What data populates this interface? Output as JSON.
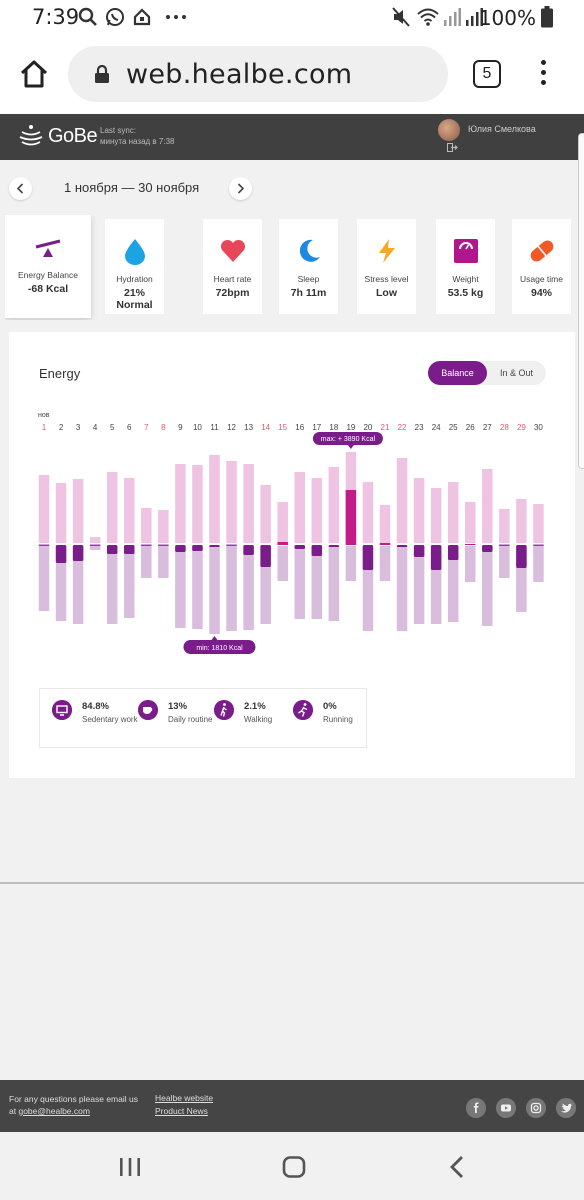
{
  "status_bar": {
    "time": "7:39",
    "battery": "100%",
    "icons": [
      "search-icon",
      "whatsapp-icon",
      "app-icon",
      "more-dots-icon",
      "mute-icon",
      "wifi-icon",
      "signal-icon",
      "battery-icon"
    ]
  },
  "browser": {
    "url": "web.healbe.com",
    "tab_count": "5"
  },
  "app_header": {
    "logo": "GoBe",
    "sync_label": "Last sync:",
    "sync_value": "минута назад в 7:38",
    "user_name": "Юлия Смелкова"
  },
  "date_nav": {
    "range": "1 ноября — 30 ноября"
  },
  "metrics": [
    {
      "label": "Energy Balance",
      "value": "-68 Kcal",
      "icon": "seesaw-icon",
      "color": "#7a1d8a"
    },
    {
      "label": "Hydration",
      "value": "21% Normal",
      "icon": "drop-icon",
      "color": "#1ba3e3"
    },
    {
      "label": "Heart rate",
      "value": "72bpm",
      "icon": "heart-icon",
      "color": "#e8475a"
    },
    {
      "label": "Sleep",
      "value": "7h 11m",
      "icon": "moon-icon",
      "color": "#1e88e5"
    },
    {
      "label": "Stress level",
      "value": "Low",
      "icon": "lightning-icon",
      "color": "#f9a825"
    },
    {
      "label": "Weight",
      "value": "53.5 kg",
      "icon": "scale-icon",
      "color": "#b3168a"
    },
    {
      "label": "Usage time",
      "value": "94%",
      "icon": "pill-icon",
      "color": "#f05a28"
    }
  ],
  "energy": {
    "title": "Energy",
    "toggle_on": "Balance",
    "toggle_off": "In & Out",
    "month_abbr": "нов",
    "max_label": "max: + 3890 Kcal",
    "min_label": "min: 1810 Kcal",
    "legend": [
      {
        "pct": "84.8%",
        "name": "Sedentary work",
        "icon": "monitor-icon"
      },
      {
        "pct": "13%",
        "name": "Daily routine",
        "icon": "cup-icon"
      },
      {
        "pct": "2.1%",
        "name": "Walking",
        "icon": "walking-icon"
      },
      {
        "pct": "0%",
        "name": "Running",
        "icon": "running-icon"
      }
    ]
  },
  "chart_data": {
    "type": "bar",
    "categories": [
      "1",
      "2",
      "3",
      "4",
      "5",
      "6",
      "7",
      "8",
      "9",
      "10",
      "11",
      "12",
      "13",
      "14",
      "15",
      "16",
      "17",
      "18",
      "19",
      "20",
      "21",
      "22",
      "23",
      "24",
      "25",
      "26",
      "27",
      "28",
      "29",
      "30"
    ],
    "weekend_days": [
      "1",
      "7",
      "8",
      "14",
      "15",
      "21",
      "22",
      "28",
      "29"
    ],
    "series": [
      {
        "values": [
          68,
          60,
          64,
          6,
          71,
          65,
          35,
          33,
          79,
          78,
          88,
          82,
          79,
          58,
          41,
          71,
          65,
          76,
          91,
          61,
          38,
          85,
          65,
          55,
          61,
          41,
          74,
          34,
          44,
          39
        ]
      },
      {
        "values": [
          -65,
          -75,
          -78,
          -4,
          -78,
          -72,
          -32,
          -32,
          -82,
          -83,
          -88,
          -85,
          -84,
          -78,
          -35,
          -73,
          -73,
          -75,
          -35,
          -85,
          -35,
          -85,
          -78,
          -78,
          -76,
          -36,
          -80,
          -32,
          -66,
          -36
        ]
      },
      {
        "values": [
          0,
          -18,
          -16,
          0,
          -9,
          -9,
          0,
          0,
          -7,
          -6,
          -2,
          0,
          -10,
          -22,
          3,
          -4,
          -11,
          -2,
          55,
          -25,
          2,
          -2,
          -12,
          -25,
          -15,
          1,
          -7,
          0,
          -23,
          0
        ]
      }
    ],
    "grid": false
  },
  "footer": {
    "contact_line": "For any questions please email us",
    "contact_at": "at",
    "email": "gobe@healbe.com",
    "link1": "Healbe website",
    "link2": "Product News",
    "social": [
      "facebook-icon",
      "youtube-icon",
      "instagram-icon",
      "twitter-icon"
    ]
  }
}
